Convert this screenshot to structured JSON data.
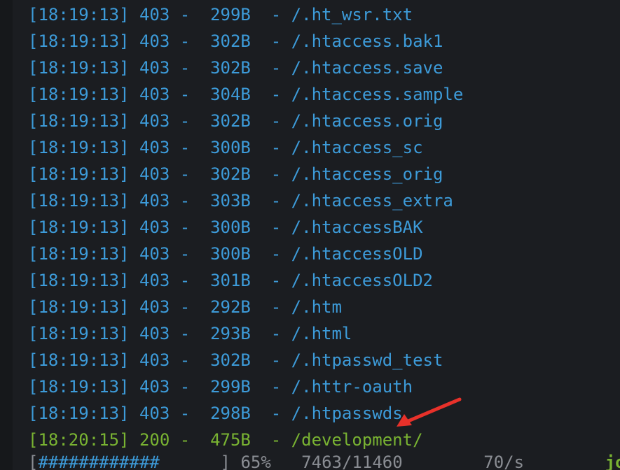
{
  "colors": {
    "background": "#1b1d21",
    "forbidden_text": "#3d9bd9",
    "found_text": "#79b332",
    "annotation_arrow": "#e8312a"
  },
  "log_lines": [
    {
      "text": "[18:19:13] 403 -  299B  - /.ht_wsr.txt",
      "status": "403"
    },
    {
      "text": "[18:19:13] 403 -  302B  - /.htaccess.bak1",
      "status": "403"
    },
    {
      "text": "[18:19:13] 403 -  302B  - /.htaccess.save",
      "status": "403"
    },
    {
      "text": "[18:19:13] 403 -  304B  - /.htaccess.sample",
      "status": "403"
    },
    {
      "text": "[18:19:13] 403 -  302B  - /.htaccess.orig",
      "status": "403"
    },
    {
      "text": "[18:19:13] 403 -  300B  - /.htaccess_sc",
      "status": "403"
    },
    {
      "text": "[18:19:13] 403 -  302B  - /.htaccess_orig",
      "status": "403"
    },
    {
      "text": "[18:19:13] 403 -  303B  - /.htaccess_extra",
      "status": "403"
    },
    {
      "text": "[18:19:13] 403 -  300B  - /.htaccessBAK",
      "status": "403"
    },
    {
      "text": "[18:19:13] 403 -  300B  - /.htaccessOLD",
      "status": "403"
    },
    {
      "text": "[18:19:13] 403 -  301B  - /.htaccessOLD2",
      "status": "403"
    },
    {
      "text": "[18:19:13] 403 -  292B  - /.htm",
      "status": "403"
    },
    {
      "text": "[18:19:13] 403 -  293B  - /.html",
      "status": "403"
    },
    {
      "text": "[18:19:13] 403 -  302B  - /.htpasswd_test",
      "status": "403"
    },
    {
      "text": "[18:19:13] 403 -  299B  - /.httr-oauth",
      "status": "403"
    },
    {
      "text": "[18:19:13] 403 -  298B  - /.htpasswds",
      "status": "403"
    },
    {
      "text": "[18:20:15] 200 -  475B  - /development/",
      "status": "200"
    }
  ],
  "progress": {
    "open_bracket": "[",
    "bar_fill": "############",
    "bar_empty": "      ",
    "close_bracket": "]",
    "percent": "65%",
    "count": "7463/11460",
    "rate": "70/s",
    "job_label": "job",
    "fraction": 0.65
  },
  "annotation": {
    "icon": "red-arrow",
    "points_to": "/.htpasswds"
  }
}
